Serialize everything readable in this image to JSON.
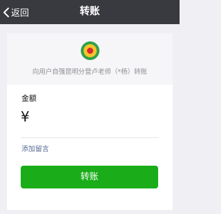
{
  "navbar": {
    "back_label": "返回",
    "title": "转账"
  },
  "payee": {
    "text": "向用户自强昆明分营卢老师（*杨）转账"
  },
  "amount": {
    "label": "金额",
    "currency_symbol": "¥",
    "value": ""
  },
  "note": {
    "add_label": "添加留言"
  },
  "submit": {
    "label": "转账"
  },
  "colors": {
    "navbar_bg": "#393a3f",
    "accent_green": "#1aad19",
    "link_blue": "#576b95",
    "page_bg": "#efeff4"
  },
  "icons": {
    "back": "chevron-left-icon",
    "payee_avatar": "organization-logo"
  }
}
